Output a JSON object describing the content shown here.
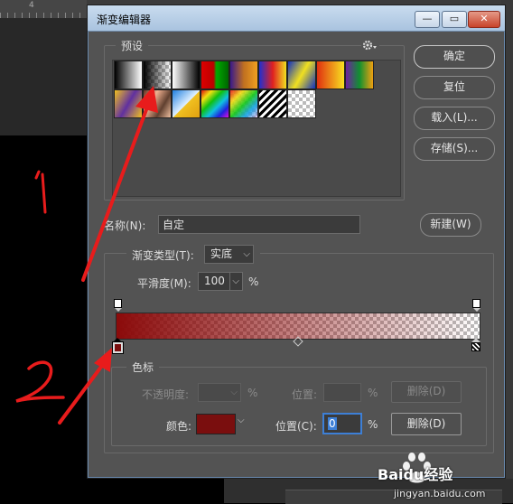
{
  "ruler": {
    "mark": "4"
  },
  "dialog": {
    "title": "渐变编辑器",
    "window_buttons": {
      "minimize": "—",
      "maximize": "▭",
      "close": "✕"
    }
  },
  "presets": {
    "legend": "预设",
    "settings_icon": "gear-icon"
  },
  "buttons": {
    "ok": "确定",
    "reset": "复位",
    "load": "载入(L)...",
    "save": "存储(S)...",
    "new": "新建(W)"
  },
  "name": {
    "label": "名称(N):",
    "value": "自定"
  },
  "gradient_type": {
    "legend_label": "渐变类型(T):",
    "selected": "实底"
  },
  "smoothness": {
    "label": "平滑度(M):",
    "value": "100",
    "unit": "%"
  },
  "color_stops": {
    "legend": "色标",
    "opacity_label": "不透明度:",
    "opacity_value": "",
    "opacity_unit": "%",
    "opacity_position_label": "位置:",
    "opacity_position_value": "",
    "opacity_position_unit": "%",
    "opacity_delete": "删除(D)",
    "color_label": "颜色:",
    "color_value": "#7a0e0e",
    "position_label": "位置(C):",
    "position_value": "0",
    "position_unit": "%",
    "delete": "删除(D)"
  },
  "gradient": {
    "start_color": "#8b0a0a",
    "midpoint": 0.5
  },
  "annotations": {
    "mark_1": "1",
    "mark_2": "2"
  },
  "watermark": {
    "brand": "Baidu经验",
    "url": "jingyan.baidu.com"
  }
}
